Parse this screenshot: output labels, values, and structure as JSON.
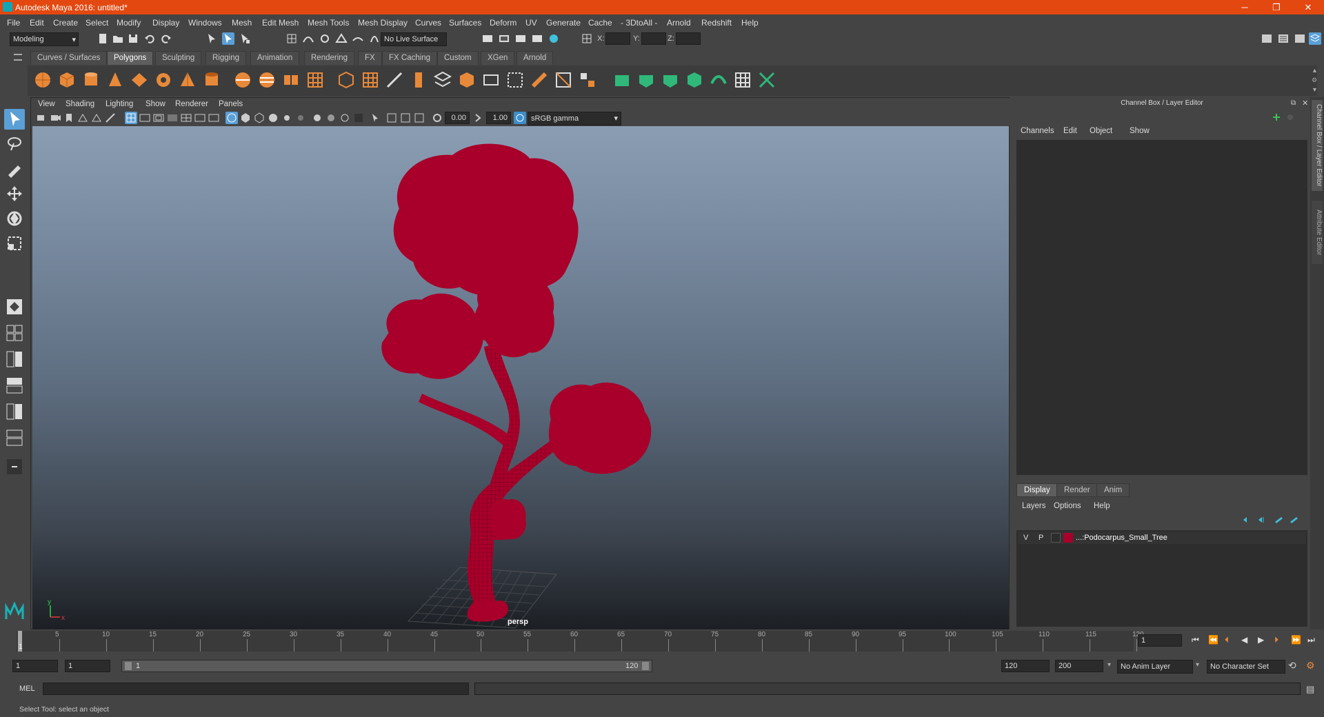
{
  "window": {
    "title": "Autodesk Maya 2016: untitled*",
    "minimize": "─",
    "restore": "❐",
    "close": "✕"
  },
  "menubar": [
    "File",
    "Edit",
    "Create",
    "Select",
    "Modify",
    "Display",
    "Windows",
    "Mesh",
    "Edit Mesh",
    "Mesh Tools",
    "Mesh Display",
    "Curves",
    "Surfaces",
    "Deform",
    "UV",
    "Generate",
    "Cache",
    "- 3DtoAll -",
    "Arnold",
    "Redshift",
    "Help"
  ],
  "status": {
    "mode": "Modeling",
    "live_surface": "No Live Surface",
    "x_label": "X:",
    "y_label": "Y:",
    "z_label": "Z:"
  },
  "shelf": {
    "tabs": [
      "Curves / Surfaces",
      "Polygons",
      "Sculpting",
      "Rigging",
      "Animation",
      "Rendering",
      "FX",
      "FX Caching",
      "Custom",
      "XGen",
      "Arnold"
    ],
    "active_tab": "Polygons"
  },
  "viewport": {
    "menus": [
      "View",
      "Shading",
      "Lighting",
      "Show",
      "Renderer",
      "Panels"
    ],
    "exposure": "0.00",
    "gamma": "1.00",
    "color_space": "sRGB gamma",
    "camera_label": "persp",
    "axis_y": "y",
    "axis_x": "x"
  },
  "channel_box": {
    "title": "Channel Box / Layer Editor",
    "menus": [
      "Channels",
      "Edit",
      "Object",
      "Show"
    ],
    "layer_tabs": [
      "Display",
      "Render",
      "Anim"
    ],
    "active_layer_tab": "Display",
    "layer_menus": [
      "Layers",
      "Options",
      "Help"
    ],
    "layer": {
      "visible": "V",
      "playback": "P",
      "name": "...:Podocarpus_Small_Tree",
      "color": "#a8002a"
    }
  },
  "side_tabs": [
    "Channel Box / Layer Editor",
    "Attribute Editor"
  ],
  "timeline": {
    "ticks": [
      "5",
      "10",
      "15",
      "20",
      "25",
      "30",
      "35",
      "40",
      "45",
      "50",
      "55",
      "60",
      "65",
      "70",
      "75",
      "80",
      "85",
      "90",
      "95",
      "100",
      "105",
      "110",
      "115",
      "120"
    ],
    "first_tick": "1",
    "current_frame": "1"
  },
  "range": {
    "start": "1",
    "playback_start": "1",
    "slider_start": "1",
    "slider_end": "120",
    "playback_end": "120",
    "end": "200",
    "anim_layer": "No Anim Layer",
    "character_set": "No Character Set"
  },
  "cmdline": {
    "label": "MEL"
  },
  "helpline": {
    "text": "Select Tool: select an object"
  },
  "colors": {
    "titlebar": "#e2480f",
    "accent": "#5a9fd6",
    "tree": "#a8002a"
  }
}
